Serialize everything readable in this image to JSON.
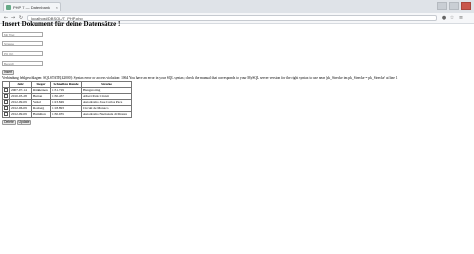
{
  "browser": {
    "tab_title": "PHP 7 — Datenbank",
    "address": "localhost/DBSQL/T_PHP.php"
  },
  "page": {
    "heading": "Insert Dokument für deine Datensätze !",
    "form": {
      "field1_placeholder": "Mit Titel",
      "field2_placeholder": "Strasse",
      "field3_placeholder": "Plz Ort",
      "field4_placeholder": "Bereich",
      "insert_label": "Insert"
    },
    "error": "Verbindung fehlgeschlagen: SQLSTATE[42000]: Syntax error or access violation: 1064 You have an error in your SQL syntax; check the manual that corresponds to your MySQL server version for the right syntax to use near 'pk_Strecke im pk_Strecke = pk_Strecke' at line 1",
    "table": {
      "headers": [
        "",
        "Jahr",
        "Sieger",
        "Schnellste Runde",
        "Strecke"
      ],
      "rows": [
        [
          "",
          "2007-07-14",
          "Räikkönen",
          "1:31.729",
          "Hungaroring"
        ],
        [
          "",
          "2010-03-28",
          "Button",
          "1:30.457",
          "Albert Park Circuit"
        ],
        [
          "",
          "2012-09-09",
          "Vettel",
          "1:23.849",
          "Autodromo Jose Carlos Pace"
        ],
        [
          "",
          "2012-06-09",
          "Rosberg",
          "1:18.893",
          "Circuit de Monaco"
        ],
        [
          "",
          "2012-09-09",
          "Hamilton",
          "1:30.935",
          "Autodromo Nazionale di Monza"
        ]
      ]
    },
    "buttons": {
      "delete_label": "Delete",
      "update_label": "Update"
    }
  }
}
